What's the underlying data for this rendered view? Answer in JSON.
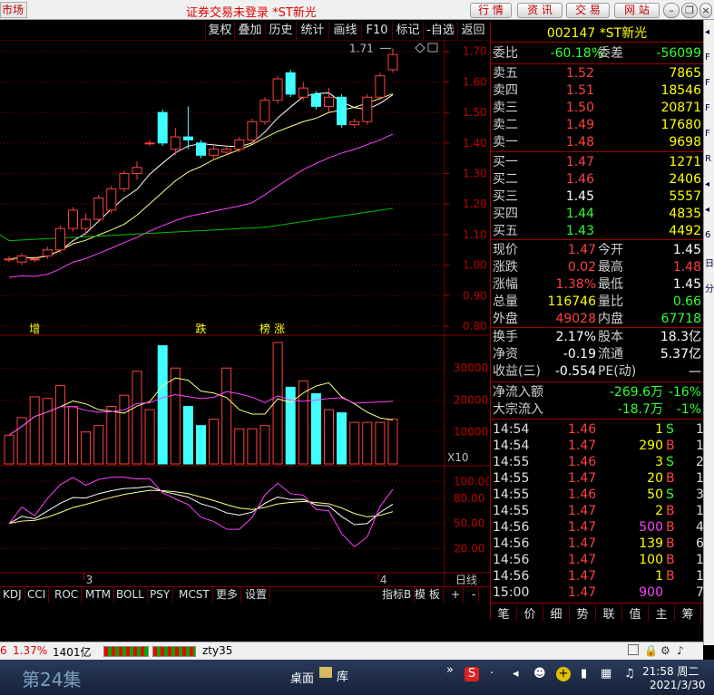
{
  "titlebar": {
    "market": "市场",
    "title": "证券交易未登录  *ST新光",
    "buttons": [
      "行 情",
      "资 讯",
      "交 易",
      "网 站"
    ]
  },
  "chart_toolbar": [
    "复权",
    "叠加",
    "历史",
    "统计",
    "画线",
    "F10",
    "标记",
    "-自选",
    "返回"
  ],
  "chart_labels": {
    "price_ticks": [
      "1.70",
      "1.60",
      "1.50",
      "1.40",
      "1.30",
      "1.20",
      "1.10",
      "1.00",
      "0.90",
      "0.80"
    ],
    "last_price_label": "1.71",
    "signal_marks": [
      "增",
      "跌",
      "榜",
      "涨"
    ],
    "vol_ticks": [
      "30000",
      "20000",
      "10000"
    ],
    "vol_unit": "X10",
    "osc_ticks": [
      "100.00",
      "80.00",
      "50.00",
      "20.00"
    ],
    "date_marks": [
      "3",
      "4"
    ],
    "period": "日线"
  },
  "indicator_tabs": [
    "KDJ",
    "CCI",
    "ROC",
    "MTM",
    "BOLL",
    "PSY",
    "MCST",
    "更多",
    "设置",
    "指标B",
    "模 板",
    "+",
    "-"
  ],
  "right_panel": {
    "code": "002147",
    "name": "*ST新光",
    "weibi_label": "委比",
    "weibi_value": "-60.18%",
    "weicha_label": "委差",
    "weicha_value": "-56099",
    "asks": [
      {
        "label": "卖五",
        "price": "1.52",
        "vol": "7865"
      },
      {
        "label": "卖四",
        "price": "1.51",
        "vol": "18546"
      },
      {
        "label": "卖三",
        "price": "1.50",
        "vol": "20871"
      },
      {
        "label": "卖二",
        "price": "1.49",
        "vol": "17680"
      },
      {
        "label": "卖一",
        "price": "1.48",
        "vol": "9698"
      }
    ],
    "bids": [
      {
        "label": "买一",
        "price": "1.47",
        "vol": "1271",
        "pc": "c-red"
      },
      {
        "label": "买二",
        "price": "1.46",
        "vol": "2406",
        "pc": "c-red"
      },
      {
        "label": "买三",
        "price": "1.45",
        "vol": "5557",
        "pc": "c-white"
      },
      {
        "label": "买四",
        "price": "1.44",
        "vol": "4835",
        "pc": "c-green"
      },
      {
        "label": "买五",
        "price": "1.43",
        "vol": "4492",
        "pc": "c-green"
      }
    ],
    "stats": [
      {
        "l1": "现价",
        "v1": "1.47",
        "c1": "c-red",
        "l2": "今开",
        "v2": "1.45",
        "c2": "c-white"
      },
      {
        "l1": "涨跌",
        "v1": "0.02",
        "c1": "c-red",
        "l2": "最高",
        "v2": "1.48",
        "c2": "c-red"
      },
      {
        "l1": "涨幅",
        "v1": "1.38%",
        "c1": "c-red",
        "l2": "最低",
        "v2": "1.45",
        "c2": "c-white"
      },
      {
        "l1": "总量",
        "v1": "116746",
        "c1": "c-yellow",
        "l2": "量比",
        "v2": "0.66",
        "c2": "c-green"
      },
      {
        "l1": "外盘",
        "v1": "49028",
        "c1": "c-red",
        "l2": "内盘",
        "v2": "67718",
        "c2": "c-green"
      }
    ],
    "stats2": [
      {
        "l1": "换手",
        "v1": "2.17%",
        "c1": "c-white",
        "l2": "股本",
        "v2": "18.3亿",
        "c2": "c-white"
      },
      {
        "l1": "净资",
        "v1": "-0.19",
        "c1": "c-white",
        "l2": "流通",
        "v2": "5.37亿",
        "c2": "c-white"
      },
      {
        "l1": "收益(三)",
        "v1": "-0.554",
        "c1": "c-white",
        "l2": "PE(动)",
        "v2": "—",
        "c2": "c-white"
      }
    ],
    "flows": [
      {
        "label": "净流入额",
        "v1": "-269.6万",
        "v2": "-16%"
      },
      {
        "label": "大宗流入",
        "v1": "-18.7万",
        "v2": "-1%"
      }
    ],
    "ticks": [
      {
        "t": "14:54",
        "p": "1.46",
        "q": "1",
        "qc": "c-yellow",
        "bs": "S",
        "bc": "c-green",
        "n": "1"
      },
      {
        "t": "14:54",
        "p": "1.47",
        "q": "290",
        "qc": "c-yellow",
        "bs": "B",
        "bc": "c-red",
        "n": "1"
      },
      {
        "t": "14:55",
        "p": "1.46",
        "q": "3",
        "qc": "c-yellow",
        "bs": "S",
        "bc": "c-green",
        "n": "2"
      },
      {
        "t": "14:55",
        "p": "1.47",
        "q": "20",
        "qc": "c-yellow",
        "bs": "B",
        "bc": "c-red",
        "n": "1"
      },
      {
        "t": "14:55",
        "p": "1.46",
        "q": "50",
        "qc": "c-yellow",
        "bs": "S",
        "bc": "c-green",
        "n": "3"
      },
      {
        "t": "14:55",
        "p": "1.47",
        "q": "2",
        "qc": "c-yellow",
        "bs": "B",
        "bc": "c-red",
        "n": "1"
      },
      {
        "t": "14:56",
        "p": "1.47",
        "q": "500",
        "qc": "c-mag",
        "bs": "B",
        "bc": "c-red",
        "n": "4"
      },
      {
        "t": "14:56",
        "p": "1.47",
        "q": "139",
        "qc": "c-yellow",
        "bs": "B",
        "bc": "c-red",
        "n": "6"
      },
      {
        "t": "14:56",
        "p": "1.47",
        "q": "100",
        "qc": "c-yellow",
        "bs": "B",
        "bc": "c-red",
        "n": "1"
      },
      {
        "t": "14:56",
        "p": "1.47",
        "q": "1",
        "qc": "c-yellow",
        "bs": "B",
        "bc": "c-red",
        "n": "1"
      },
      {
        "t": "15:00",
        "p": "1.47",
        "q": "900",
        "qc": "c-mag",
        "bs": "",
        "bc": "c-red",
        "n": "7"
      }
    ],
    "tabs": [
      "笔",
      "价",
      "细",
      "势",
      "联",
      "值",
      "主",
      "筹"
    ]
  },
  "statusbar": {
    "change": "6",
    "pct": "1.37%",
    "amount": "1401亿",
    "user": "zty35"
  },
  "taskbar": {
    "left_text": "第24集",
    "desktop": "桌面",
    "lib": "库",
    "time": "21:58 周二",
    "date": "2021/3/30"
  },
  "colors": {
    "up": "#ff4040",
    "down": "#40ffff",
    "ma_white": "#ffffff",
    "ma_yellow": "#ffff80",
    "ma_magenta": "#ff40ff",
    "ma_green": "#00c000",
    "grid": "#800000"
  },
  "chart_data": {
    "type": "candlestick",
    "price_axis": [
      0.8,
      1.72
    ],
    "candles": [
      {
        "o": 1.02,
        "c": 1.02,
        "h": 1.03,
        "l": 1.01
      },
      {
        "o": 1.01,
        "c": 1.03,
        "h": 1.04,
        "l": 1.0
      },
      {
        "o": 1.02,
        "c": 1.02,
        "h": 1.03,
        "l": 1.01
      },
      {
        "o": 1.03,
        "c": 1.05,
        "h": 1.06,
        "l": 1.02
      },
      {
        "o": 1.05,
        "c": 1.12,
        "h": 1.13,
        "l": 1.04
      },
      {
        "o": 1.12,
        "c": 1.18,
        "h": 1.19,
        "l": 1.11
      },
      {
        "o": 1.12,
        "c": 1.15,
        "h": 1.17,
        "l": 1.1
      },
      {
        "o": 1.15,
        "c": 1.22,
        "h": 1.23,
        "l": 1.14
      },
      {
        "o": 1.18,
        "c": 1.25,
        "h": 1.26,
        "l": 1.17
      },
      {
        "o": 1.25,
        "c": 1.3,
        "h": 1.31,
        "l": 1.24
      },
      {
        "o": 1.3,
        "c": 1.32,
        "h": 1.34,
        "l": 1.28
      },
      {
        "o": 1.4,
        "c": 1.4,
        "h": 1.41,
        "l": 1.39
      },
      {
        "o": 1.5,
        "c": 1.4,
        "h": 1.51,
        "l": 1.39
      },
      {
        "o": 1.38,
        "c": 1.42,
        "h": 1.45,
        "l": 1.36
      },
      {
        "o": 1.42,
        "c": 1.41,
        "h": 1.52,
        "l": 1.38
      },
      {
        "o": 1.4,
        "c": 1.36,
        "h": 1.41,
        "l": 1.35
      },
      {
        "o": 1.36,
        "c": 1.38,
        "h": 1.39,
        "l": 1.35
      },
      {
        "o": 1.37,
        "c": 1.38,
        "h": 1.39,
        "l": 1.36
      },
      {
        "o": 1.38,
        "c": 1.41,
        "h": 1.42,
        "l": 1.37
      },
      {
        "o": 1.41,
        "c": 1.47,
        "h": 1.48,
        "l": 1.4
      },
      {
        "o": 1.47,
        "c": 1.54,
        "h": 1.55,
        "l": 1.46
      },
      {
        "o": 1.54,
        "c": 1.61,
        "h": 1.62,
        "l": 1.53
      },
      {
        "o": 1.63,
        "c": 1.56,
        "h": 1.64,
        "l": 1.55
      },
      {
        "o": 1.55,
        "c": 1.58,
        "h": 1.6,
        "l": 1.54
      },
      {
        "o": 1.56,
        "c": 1.52,
        "h": 1.57,
        "l": 1.51
      },
      {
        "o": 1.52,
        "c": 1.55,
        "h": 1.58,
        "l": 1.5
      },
      {
        "o": 1.55,
        "c": 1.46,
        "h": 1.56,
        "l": 1.45
      },
      {
        "o": 1.46,
        "c": 1.47,
        "h": 1.48,
        "l": 1.45
      },
      {
        "o": 1.47,
        "c": 1.55,
        "h": 1.56,
        "l": 1.46
      },
      {
        "o": 1.55,
        "c": 1.62,
        "h": 1.63,
        "l": 1.54
      },
      {
        "o": 1.64,
        "c": 1.69,
        "h": 1.71,
        "l": 1.63
      }
    ],
    "volume": [
      9000,
      14500,
      21000,
      20500,
      24500,
      18000,
      10000,
      12000,
      18000,
      21500,
      29000,
      17000,
      37000,
      30000,
      18000,
      12000,
      14000,
      30000,
      11000,
      11000,
      12000,
      38000,
      24000,
      26000,
      22000,
      17000,
      16000,
      13000,
      13000,
      13000,
      14000
    ],
    "volume_axis": [
      0,
      38000
    ]
  }
}
